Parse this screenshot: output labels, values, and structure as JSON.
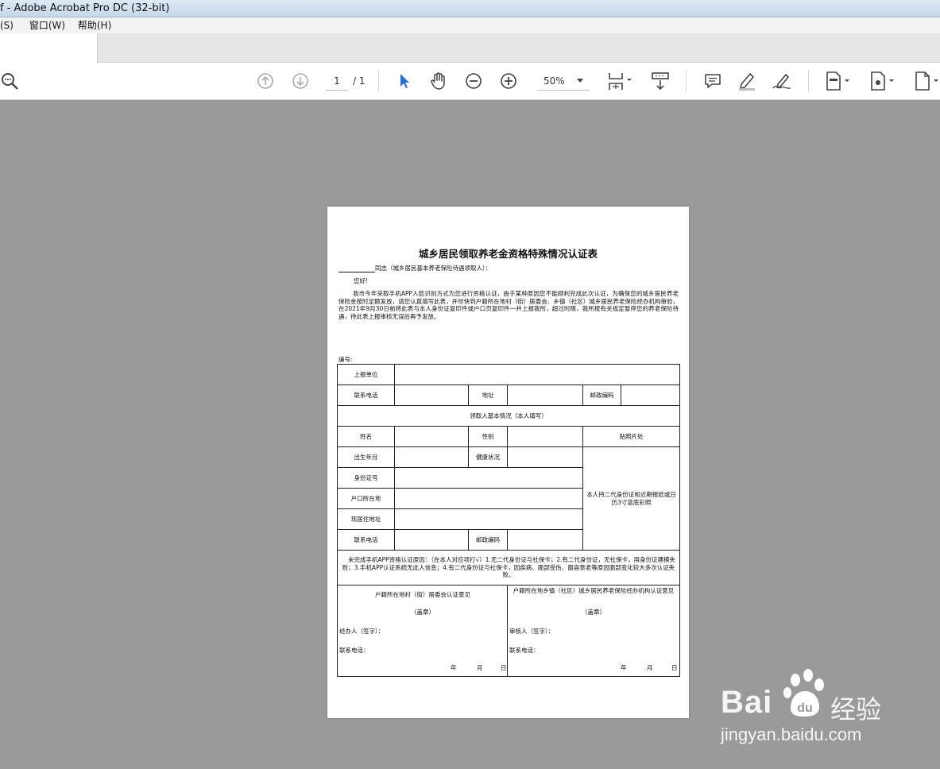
{
  "window": {
    "title": "f - Adobe Acrobat Pro DC (32-bit)"
  },
  "menu": {
    "items": [
      "(S)",
      "窗口(W)",
      "帮助(H)"
    ]
  },
  "toolbar": {
    "page_current": "1",
    "page_total": "/ 1",
    "zoom": "50%",
    "icons": [
      "zoom-search-icon",
      "page-up-icon",
      "page-down-icon",
      "select-cursor-icon",
      "hand-icon",
      "zoom-out-icon",
      "zoom-in-icon",
      "fit-page-icon",
      "scroll-mode-icon",
      "comment-icon",
      "highlight-icon",
      "sign-icon",
      "doc-tool-1-icon",
      "doc-tool-2-icon",
      "doc-tool-3-icon"
    ]
  },
  "document": {
    "title": "城乡居民领取养老金资格特殊情况认证表",
    "salutation_line": "同志（城乡居民基本养老保险待遇领取人）：",
    "greeting": "您好!",
    "paragraph": "我市今年采取手机APP人脸识别方式为您进行资格认证，由于某种原因您不能顺利完成此次认证，为确保您的城乡居民养老保险金按时足额发放，请您认真填写此表，并尽快到户籍所在地村（街）居委会、乡镇（社区）城乡居民养老保险经办机构审验，在2021年9月30日前将此表与本人身份证复印件或户口页复印件一并上报我所，超过时限，我所按有关规定暂停您的养老保险待遇，待此表上报审核无误后再予发放。",
    "number_label": "编号:",
    "table": {
      "report_unit": "上报单位",
      "phone": "联系电话",
      "address": "地址",
      "postcode": "邮政编码",
      "basic_info_header": "领取人基本情况（本人填写）",
      "name": "姓名",
      "gender": "性别",
      "photo_slot": "贴照片处",
      "birth": "出生年月",
      "health": "健康状况",
      "id_number": "身份证号",
      "hukou": "户口所在地",
      "residence": "现居住地址",
      "phone2": "联系电话",
      "postcode2": "邮政编码",
      "photo_note": "本人持二代身份证和近期报纸或日历3寸蓝底彩照",
      "reason": "未完成手机APP资格认证原因：（在本人对应项打√）1.无二代身份证与社保卡；2.有二代身份证，无社保卡，用身份证建模失败；3.手机APP认证系统无此人信息；4.有二代身份证与社保卡，因疾病、面部受伤、面容衰老等原因面部变化较大多次认证失败。",
      "left_opinion_title": "户籍所在地村（街）居委会认证意见",
      "right_opinion_title": "户籍所在地乡镇（社区）城乡居民养老保险经办机构认证意见",
      "seal": "（盖章）",
      "handler": "经办人（签字）：",
      "reviewer": "审核人（签字）：",
      "contact_phone": "联系电话：",
      "date_year": "年",
      "date_month": "月",
      "date_day": "日"
    }
  },
  "watermark": {
    "brand": "Bai",
    "brand2": "经验",
    "url": "jingyan.baidu.com"
  }
}
